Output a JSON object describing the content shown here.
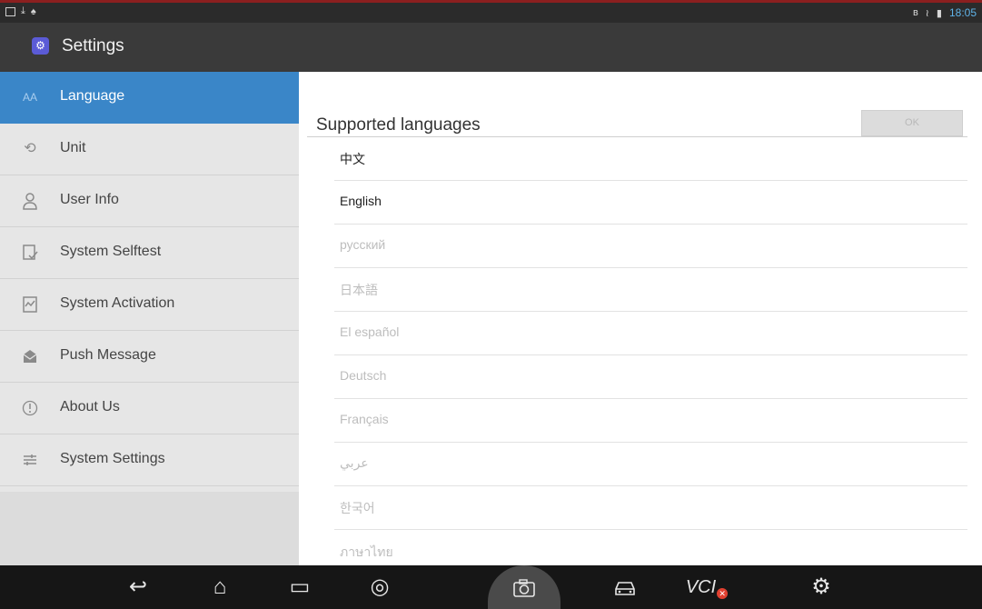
{
  "status_bar": {
    "time": "18:05"
  },
  "app": {
    "title": "Settings",
    "icon": "settings-gear-icon"
  },
  "sidebar": {
    "items": [
      {
        "label": "Language",
        "icon": "font-size-icon",
        "active": true
      },
      {
        "label": "Unit",
        "icon": "unit-convert-icon",
        "active": false
      },
      {
        "label": "User Info",
        "icon": "user-icon",
        "active": false
      },
      {
        "label": "System Selftest",
        "icon": "selftest-icon",
        "active": false
      },
      {
        "label": "System Activation",
        "icon": "activation-icon",
        "active": false
      },
      {
        "label": "Push Message",
        "icon": "message-icon",
        "active": false
      },
      {
        "label": "About Us",
        "icon": "info-icon",
        "active": false
      },
      {
        "label": "System Settings",
        "icon": "sliders-icon",
        "active": false
      }
    ]
  },
  "main": {
    "title": "Supported languages",
    "ok_label": "OK",
    "languages": [
      {
        "label": "中文",
        "enabled": true
      },
      {
        "label": "English",
        "enabled": true
      },
      {
        "label": "русский",
        "enabled": false
      },
      {
        "label": "日本語",
        "enabled": false
      },
      {
        "label": "El español",
        "enabled": false
      },
      {
        "label": "Deutsch",
        "enabled": false
      },
      {
        "label": "Français",
        "enabled": false
      },
      {
        "label": "عربي",
        "enabled": false
      },
      {
        "label": "한국어",
        "enabled": false
      },
      {
        "label": "ภาษาไทย",
        "enabled": false
      }
    ]
  },
  "navbar": {
    "vci_label": "VCI",
    "items": [
      "back-icon",
      "home-icon",
      "recent-apps-icon",
      "browser-icon",
      "camera-icon",
      "car-icon",
      "vci-icon",
      "settings-icon"
    ]
  },
  "colors": {
    "accent": "#3a86c8",
    "titlebar": "#3a3a3a",
    "sidebar_bg": "#e6e6e6",
    "navbar": "#161616"
  }
}
